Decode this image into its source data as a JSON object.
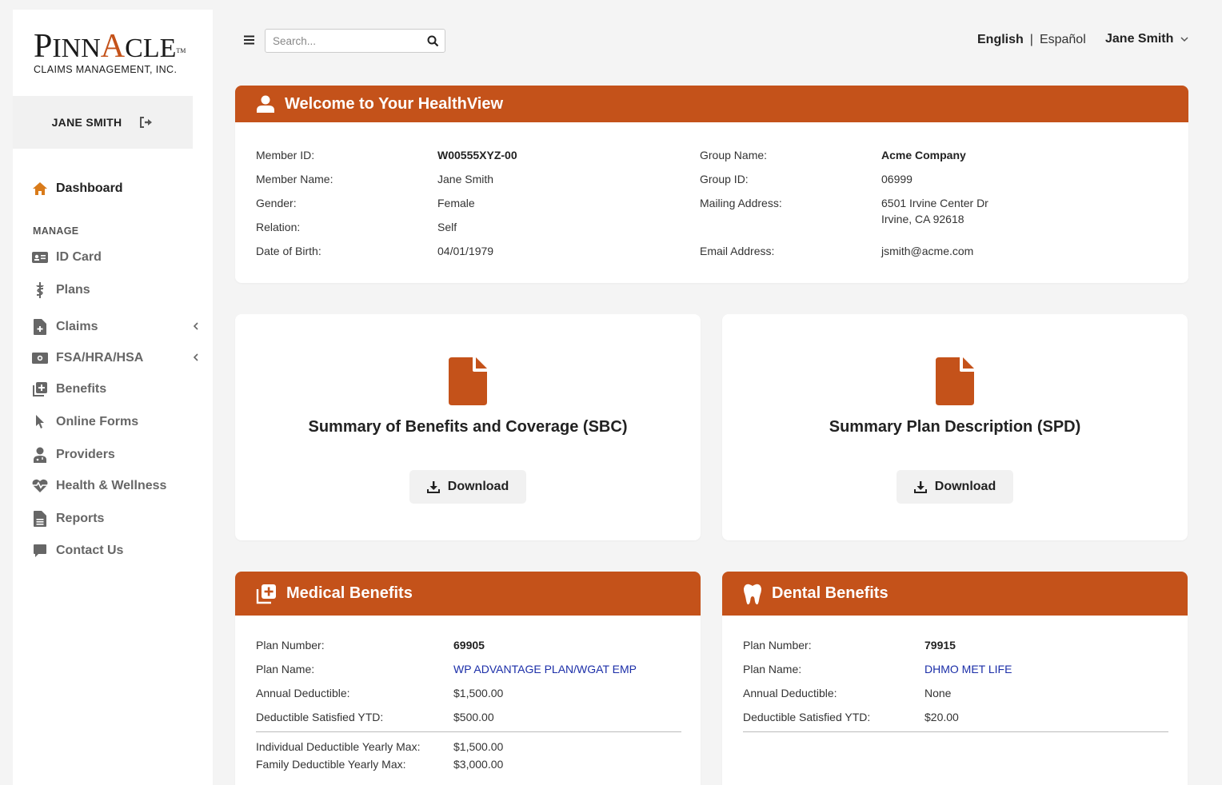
{
  "brand": {
    "logo_main": "PINNACLE",
    "logo_sub": "CLAIMS MANAGEMENT, INC.",
    "logo_tm": "TM",
    "accent_color": "#c4521a"
  },
  "sidebar": {
    "user_name": "JANE SMITH",
    "dashboard": "Dashboard",
    "manage_heading": "MANAGE",
    "items": [
      {
        "label": "ID Card",
        "icon": "id-card-icon"
      },
      {
        "label": "Plans",
        "icon": "caduceus-icon"
      },
      {
        "label": "Claims",
        "icon": "file-medical-icon",
        "submenu": true
      },
      {
        "label": "FSA/HRA/HSA",
        "icon": "money-bill-icon",
        "submenu": true
      },
      {
        "label": "Benefits",
        "icon": "notes-medical-icon"
      },
      {
        "label": "Online Forms",
        "icon": "pointer-icon"
      },
      {
        "label": "Providers",
        "icon": "user-doctor-icon"
      },
      {
        "label": "Health & Wellness",
        "icon": "heart-pulse-icon"
      },
      {
        "label": "Reports",
        "icon": "file-lines-icon"
      },
      {
        "label": "Contact Us",
        "icon": "comment-icon"
      }
    ]
  },
  "topbar": {
    "search_placeholder": "Search...",
    "lang_en": "English",
    "lang_sep": "|",
    "lang_es": "Español",
    "user_menu": "Jane Smith"
  },
  "welcome": {
    "title": "Welcome to Your HealthView",
    "left": [
      {
        "label": "Member ID:",
        "value": "W00555XYZ-00"
      },
      {
        "label": "Member Name:",
        "value": "Jane Smith"
      },
      {
        "label": "Gender:",
        "value": "Female"
      },
      {
        "label": "Relation:",
        "value": "Self"
      },
      {
        "label": "Date of Birth:",
        "value": "04/01/1979"
      }
    ],
    "right": {
      "group_name_label": "Group Name:",
      "group_name": "Acme Company",
      "group_id_label": "Group ID:",
      "group_id": "06999",
      "mailing_label": "Mailing Address:",
      "mailing_line1": "6501 Irvine Center Dr",
      "mailing_line2": "Irvine, CA 92618",
      "email_label": "Email Address:",
      "email": "jsmith@acme.com"
    }
  },
  "docs": [
    {
      "title": "Summary of Benefits and Coverage (SBC)",
      "button": "Download"
    },
    {
      "title": "Summary Plan Description (SPD)",
      "button": "Download"
    }
  ],
  "medical": {
    "title": "Medical Benefits",
    "plan_number_label": "Plan Number:",
    "plan_number": "69905",
    "plan_name_label": "Plan Name:",
    "plan_name": "WP ADVANTAGE PLAN/WGAT EMP",
    "annual_deductible_label": "Annual Deductible:",
    "annual_deductible": "$1,500.00",
    "satisfied_label": "Deductible Satisfied YTD:",
    "satisfied": "$500.00",
    "ind_max_label": "Individual Deductible Yearly Max:",
    "ind_max": "$1,500.00",
    "fam_max_label": "Family Deductible Yearly Max:",
    "fam_max": "$3,000.00"
  },
  "dental": {
    "title": "Dental Benefits",
    "plan_number_label": "Plan Number:",
    "plan_number": "79915",
    "plan_name_label": "Plan Name:",
    "plan_name": "DHMO MET LIFE",
    "annual_deductible_label": "Annual Deductible:",
    "annual_deductible": "None",
    "satisfied_label": "Deductible Satisfied YTD:",
    "satisfied": "$20.00"
  }
}
